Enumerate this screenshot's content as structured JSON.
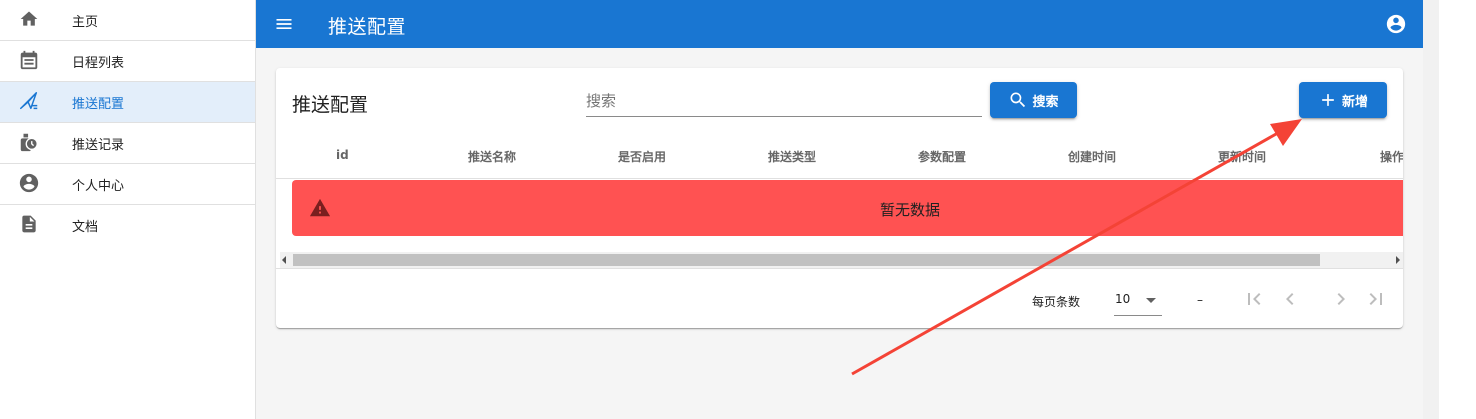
{
  "sidebar": {
    "items": [
      {
        "label": "主页",
        "icon": "home-icon"
      },
      {
        "label": "日程列表",
        "icon": "calendar-icon"
      },
      {
        "label": "推送配置",
        "icon": "send-icon",
        "active": true
      },
      {
        "label": "推送记录",
        "icon": "history-icon"
      },
      {
        "label": "个人中心",
        "icon": "account-circle-icon"
      },
      {
        "label": "文档",
        "icon": "document-icon"
      }
    ]
  },
  "header": {
    "title": "推送配置",
    "menu_icon": "menu-icon",
    "account_icon": "account-circle-icon"
  },
  "card": {
    "title": "推送配置",
    "search_placeholder": "搜索",
    "search_value": "",
    "search_button": "搜索",
    "add_button": "新增",
    "columns": [
      "id",
      "推送名称",
      "是否启用",
      "推送类型",
      "参数配置",
      "创建时间",
      "更新时间",
      "操作"
    ],
    "empty_message": "暂无数据",
    "footer": {
      "rows_per_page_label": "每页条数",
      "rows_per_page": "10",
      "range": "–"
    }
  },
  "colors": {
    "primary": "#1976d2",
    "error": "#ff5252",
    "annotation_arrow": "#f44336",
    "active_nav_bg": "#e3eefa"
  }
}
